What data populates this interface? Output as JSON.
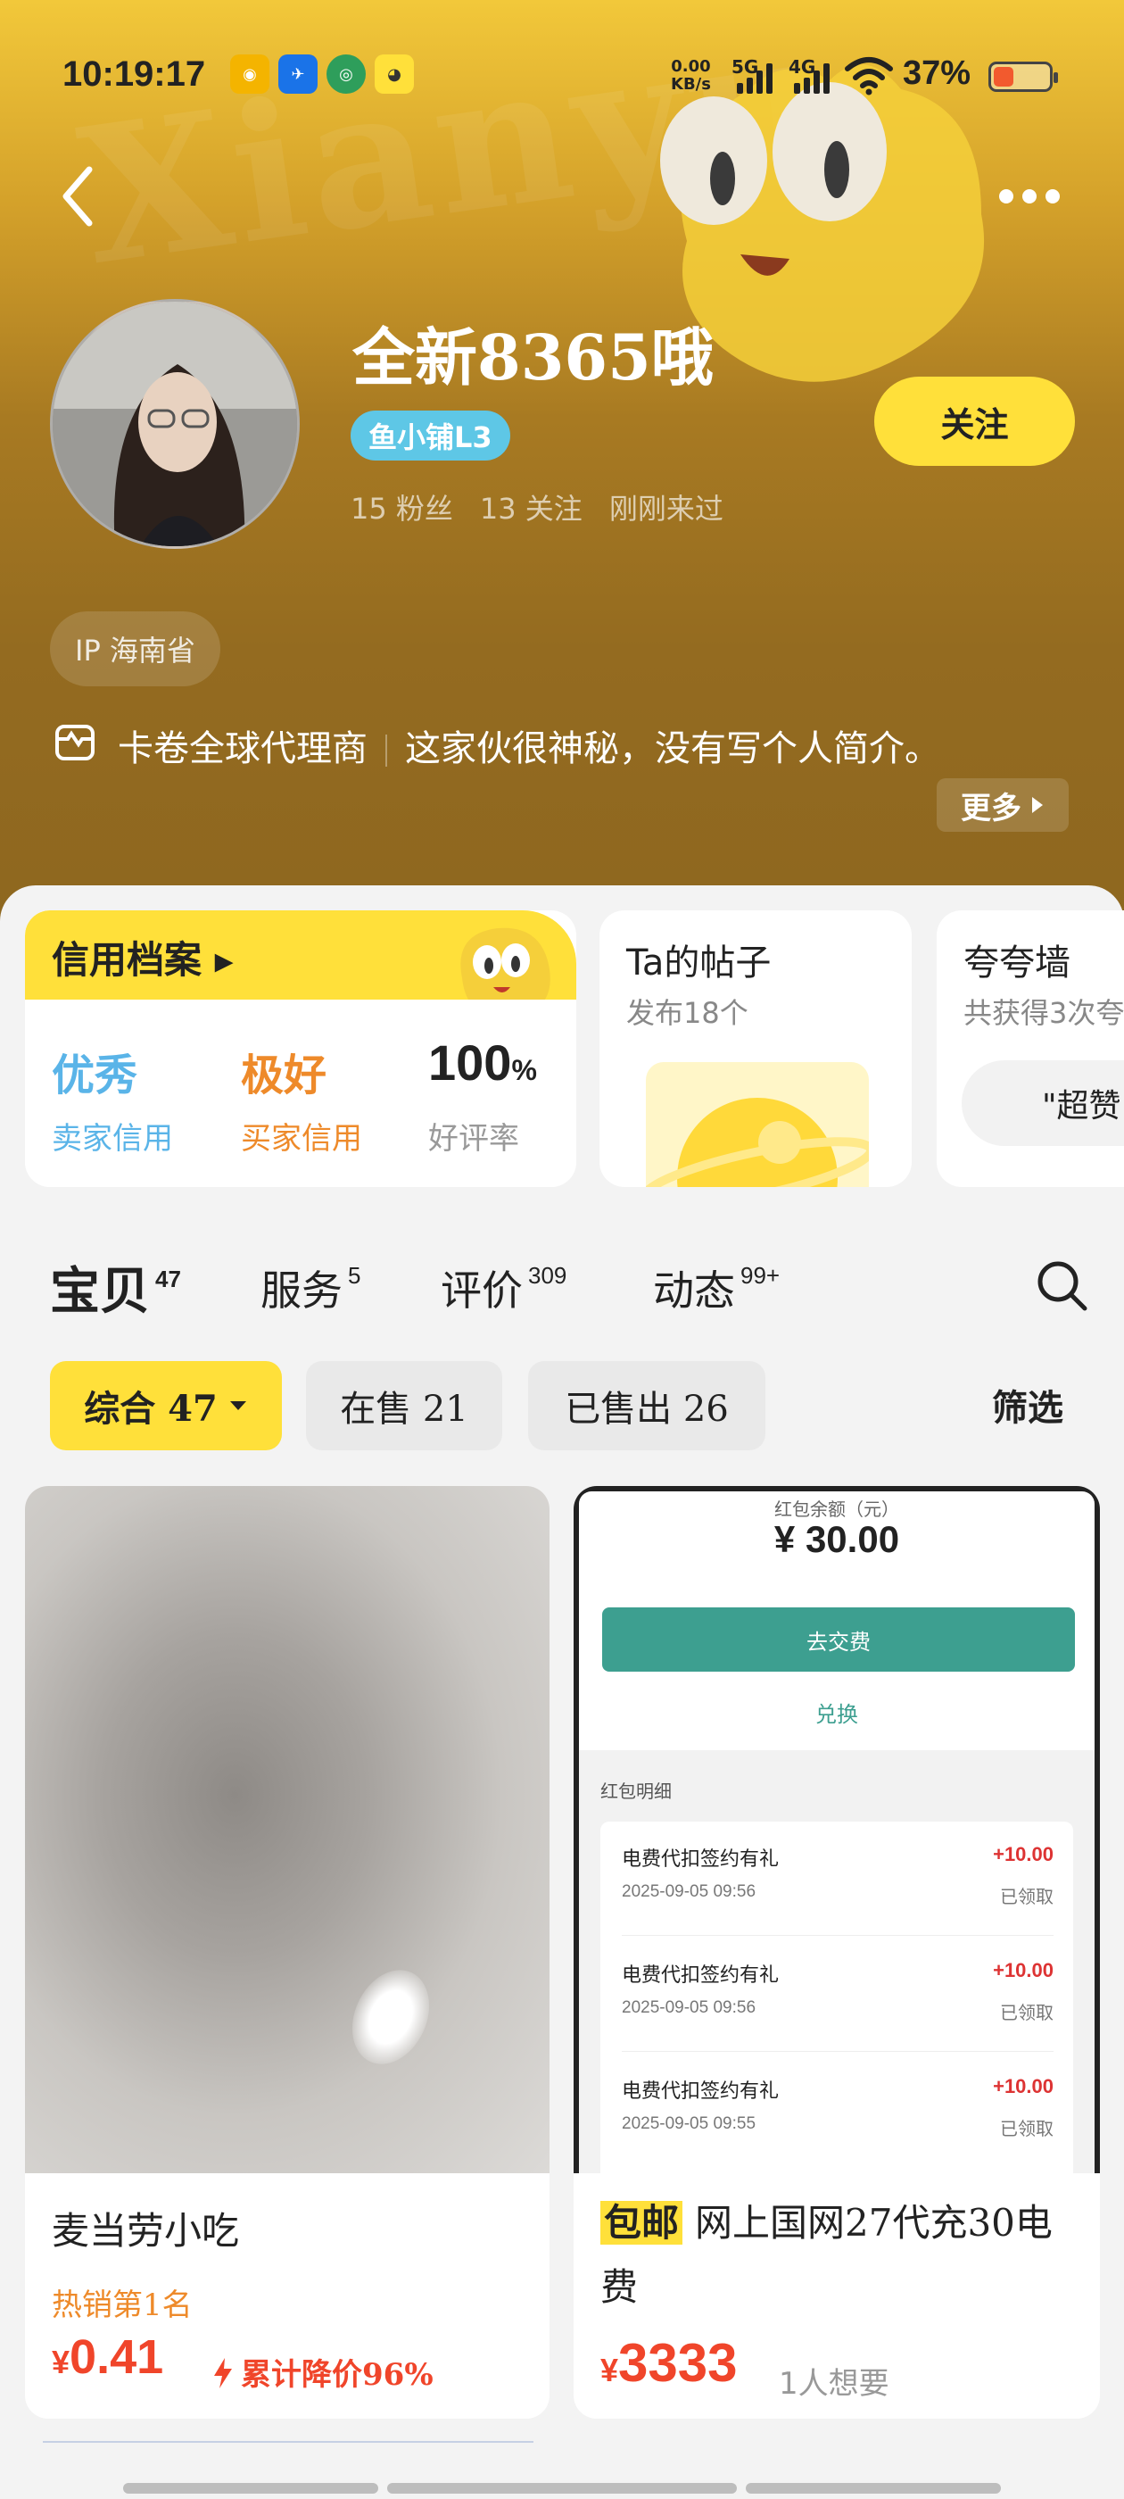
{
  "status_bar": {
    "time": "10:19:17",
    "net_speed": "0.00",
    "net_unit": "KB/s",
    "signal1": "5G",
    "signal2": "4G",
    "battery_pct": "37%",
    "battery_level": 0.37,
    "app_icons": [
      "app-icon-1",
      "app-icon-2",
      "app-icon-3",
      "app-icon-4"
    ]
  },
  "profile": {
    "nickname": "全新8365哦",
    "level": "鱼小铺L3",
    "followers": "15 粉丝",
    "following": "13 关注",
    "last_seen": "刚刚来过",
    "follow_label": "关注",
    "ip": "IP 海南省",
    "bio_tag": "卡卷全球代理商",
    "bio_text": "这家伙很神秘，没有写个人简介。",
    "more_label": "更多"
  },
  "credit": {
    "title": "信用档案",
    "seller_value": "优秀",
    "seller_label": "卖家信用",
    "buyer_value": "极好",
    "buyer_label": "买家信用",
    "rate_value": "100",
    "rate_unit": "%",
    "rate_label": "好评率",
    "colors": {
      "seller": "#5ab4e8",
      "buyer": "#ee8a2a"
    }
  },
  "posts": {
    "title": "Ta的帖子",
    "sub": "发布18个"
  },
  "praise": {
    "title": "夸夸墙",
    "sub": "共获得3次夸",
    "pill": "\"超赞"
  },
  "tabs": [
    {
      "label": "宝贝",
      "count": "47"
    },
    {
      "label": "服务",
      "count": "5"
    },
    {
      "label": "评价",
      "count": "309"
    },
    {
      "label": "动态",
      "count": "99+"
    }
  ],
  "chips": {
    "all": "综合 47",
    "on_sale": "在售 21",
    "sold": "已售出 26",
    "filter": "筛选"
  },
  "products": [
    {
      "title": "麦当劳小吃",
      "rank": "热销第1名",
      "currency": "¥",
      "price": "0.41",
      "drop": "累计降价96%"
    },
    {
      "badge": "包邮",
      "title": "网上国网27代充30电费",
      "currency": "¥",
      "price": "3333",
      "want": "1人想要",
      "screenshot": {
        "label": "红包余额（元）",
        "amount": "¥ 30.00",
        "pay_btn": "去交费",
        "exchange": "兑换",
        "detail_head": "红包明细",
        "rows": [
          {
            "name": "电费代扣签约有礼",
            "date": "2025-09-05 09:56",
            "amount": "+10.00",
            "state": "已领取"
          },
          {
            "name": "电费代扣签约有礼",
            "date": "2025-09-05 09:56",
            "amount": "+10.00",
            "state": "已领取"
          },
          {
            "name": "电费代扣签约有礼",
            "date": "2025-09-05 09:55",
            "amount": "+10.00",
            "state": "已领取"
          }
        ]
      }
    }
  ],
  "theme": {
    "accent": "#ffe03a",
    "price": "#f0452a"
  }
}
